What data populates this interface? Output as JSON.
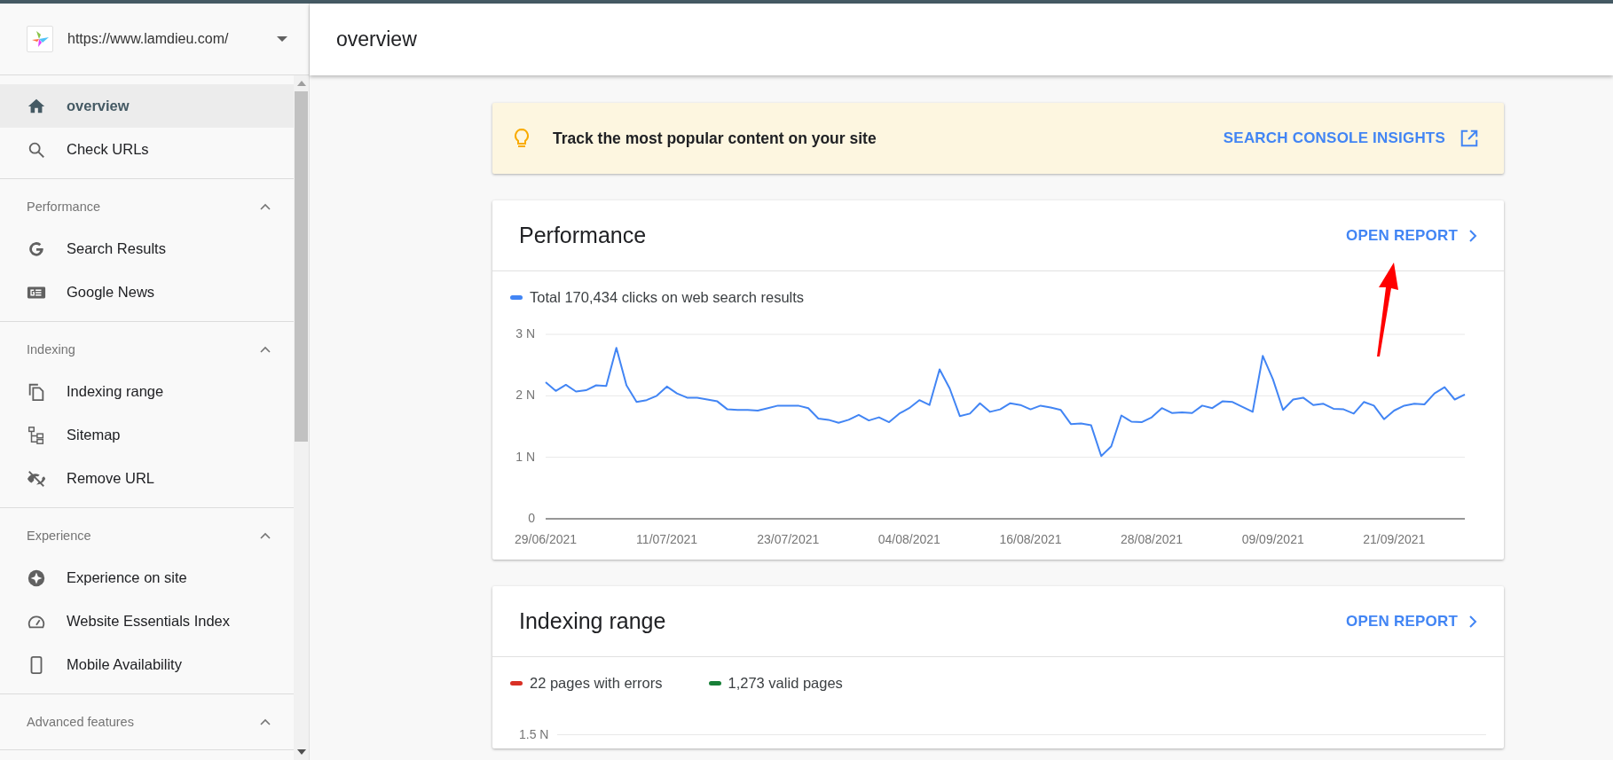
{
  "site_selector": {
    "url": "https://www.lamdieu.com/"
  },
  "nav": [
    {
      "label": "overview",
      "kind": "home",
      "selected": true
    },
    {
      "label": "Check URLs",
      "kind": "search",
      "selected": false
    }
  ],
  "sections": [
    {
      "title": "Performance",
      "expanded": true,
      "items": [
        {
          "label": "Search Results",
          "kind": "google",
          "selected": false
        },
        {
          "label": "Google News",
          "kind": "news",
          "selected": false
        }
      ]
    },
    {
      "title": "Indexing",
      "expanded": true,
      "items": [
        {
          "label": "Indexing range",
          "kind": "pages",
          "selected": false
        },
        {
          "label": "Sitemap",
          "kind": "sitemap",
          "selected": false
        },
        {
          "label": "Remove URL",
          "kind": "hidden",
          "selected": false
        }
      ]
    },
    {
      "title": "Experience",
      "expanded": true,
      "items": [
        {
          "label": "Experience on site",
          "kind": "experience",
          "selected": false
        },
        {
          "label": "Website Essentials Index",
          "kind": "gauge",
          "selected": false
        },
        {
          "label": "Mobile Availability",
          "kind": "phone",
          "selected": false
        }
      ]
    },
    {
      "title": "Advanced features",
      "expanded": true
    }
  ],
  "page": {
    "title": "overview"
  },
  "banner": {
    "text": "Track the most popular content on your site",
    "link": "SEARCH CONSOLE INSIGHTS"
  },
  "cards": [
    {
      "title": "Performance",
      "link": "OPEN REPORT",
      "chart_data": {
        "type": "line",
        "ylim": [
          0,
          3
        ],
        "yticks": [
          {
            "value": 0,
            "label": "0"
          },
          {
            "value": 1,
            "label": "1 N"
          },
          {
            "value": 2,
            "label": "2 N"
          },
          {
            "value": 3,
            "label": "3 N"
          }
        ],
        "categories": [
          "29/06/2021",
          null,
          null,
          null,
          null,
          null,
          null,
          null,
          null,
          null,
          null,
          null,
          "11/07/2021",
          null,
          null,
          null,
          null,
          null,
          null,
          null,
          null,
          null,
          null,
          null,
          "23/07/2021",
          null,
          null,
          null,
          null,
          null,
          null,
          null,
          null,
          null,
          null,
          null,
          "04/08/2021",
          null,
          null,
          null,
          null,
          null,
          null,
          null,
          null,
          null,
          null,
          null,
          "16/08/2021",
          null,
          null,
          null,
          null,
          null,
          null,
          null,
          null,
          null,
          null,
          null,
          "28/08/2021",
          null,
          null,
          null,
          null,
          null,
          null,
          null,
          null,
          null,
          null,
          null,
          "09/09/2021",
          null,
          null,
          null,
          null,
          null,
          null,
          null,
          null,
          null,
          null,
          null,
          "21/09/2021",
          null,
          null,
          null,
          null,
          null,
          null,
          null
        ],
        "series": [
          {
            "name": "Total 170,434 clicks on web search results",
            "color": "#4285f4",
            "values": [
              2.22,
              2.08,
              2.18,
              2.07,
              2.09,
              2.17,
              2.16,
              2.78,
              2.17,
              1.9,
              1.93,
              2.0,
              2.15,
              2.04,
              1.97,
              1.97,
              1.94,
              1.91,
              1.78,
              1.77,
              1.77,
              1.76,
              1.8,
              1.84,
              1.84,
              1.84,
              1.8,
              1.63,
              1.61,
              1.56,
              1.61,
              1.69,
              1.6,
              1.65,
              1.57,
              1.71,
              1.8,
              1.93,
              1.85,
              2.43,
              2.12,
              1.67,
              1.71,
              1.88,
              1.74,
              1.78,
              1.88,
              1.85,
              1.78,
              1.84,
              1.81,
              1.77,
              1.54,
              1.55,
              1.52,
              1.02,
              1.18,
              1.68,
              1.58,
              1.57,
              1.65,
              1.8,
              1.72,
              1.73,
              1.72,
              1.84,
              1.8,
              1.91,
              1.9,
              1.82,
              1.74,
              2.65,
              2.27,
              1.77,
              1.94,
              1.97,
              1.85,
              1.87,
              1.79,
              1.78,
              1.71,
              1.9,
              1.84,
              1.62,
              1.76,
              1.84,
              1.87,
              1.86,
              2.04,
              2.14,
              1.94,
              2.02
            ]
          }
        ]
      }
    },
    {
      "title": "Indexing range",
      "link": "OPEN REPORT",
      "legend": [
        {
          "label": "22 pages with errors",
          "color": "#d93025"
        },
        {
          "label": "1,273 valid pages",
          "color": "#188038"
        }
      ],
      "axis_label": "1.5 N"
    }
  ]
}
